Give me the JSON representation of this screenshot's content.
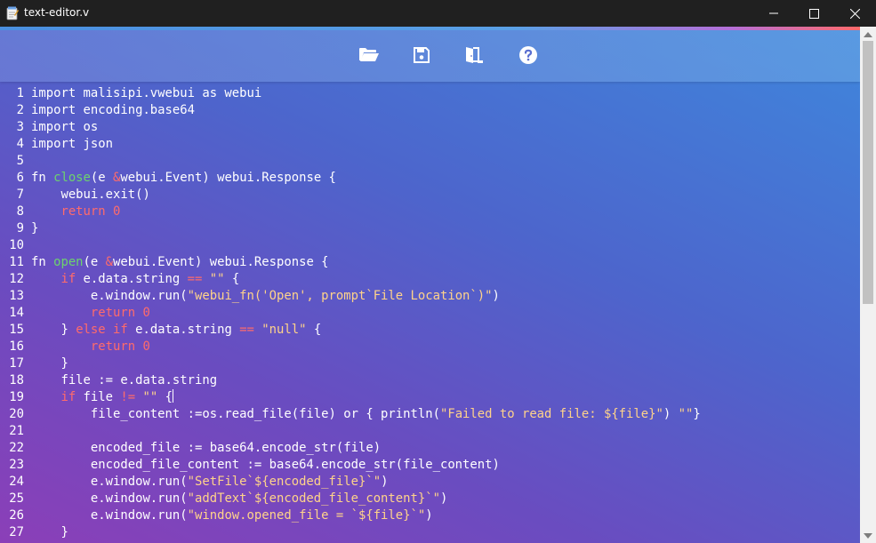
{
  "window": {
    "title": "text-editor.v",
    "app_icon": "notepad-icon",
    "controls": [
      "minimize-icon",
      "maximize-icon",
      "close-icon"
    ]
  },
  "toolbar": {
    "buttons": [
      {
        "name": "open-button",
        "icon": "folder-open-icon"
      },
      {
        "name": "save-button",
        "icon": "floppy-save-icon"
      },
      {
        "name": "exit-button",
        "icon": "door-exit-icon"
      },
      {
        "name": "help-button",
        "icon": "question-circle-icon"
      }
    ]
  },
  "colors": {
    "titlebar": "#202020",
    "keyword": "#ff6b6b",
    "function_name": "#6dd36d",
    "string": "#ffd38a",
    "number": "#ff6b6b",
    "text": "#ffffff"
  },
  "editor": {
    "lines": [
      {
        "n": "1",
        "tokens": [
          {
            "t": "import malisipi.vwebui as webui"
          }
        ]
      },
      {
        "n": "2",
        "tokens": [
          {
            "t": "import encoding.base64"
          }
        ]
      },
      {
        "n": "3",
        "tokens": [
          {
            "t": "import os"
          }
        ]
      },
      {
        "n": "4",
        "tokens": [
          {
            "t": "import json"
          }
        ]
      },
      {
        "n": "5",
        "tokens": []
      },
      {
        "n": "6",
        "tokens": [
          {
            "t": "fn "
          },
          {
            "t": "close",
            "c": "fnname"
          },
          {
            "t": "(e "
          },
          {
            "t": "&",
            "c": "kw"
          },
          {
            "t": "webui.Event) webui.Response {"
          }
        ]
      },
      {
        "n": "7",
        "tokens": [
          {
            "t": "    webui.exit()"
          }
        ]
      },
      {
        "n": "8",
        "tokens": [
          {
            "t": "    "
          },
          {
            "t": "return",
            "c": "kw"
          },
          {
            "t": " "
          },
          {
            "t": "0",
            "c": "num"
          }
        ]
      },
      {
        "n": "9",
        "tokens": [
          {
            "t": "}"
          }
        ]
      },
      {
        "n": "10",
        "tokens": []
      },
      {
        "n": "11",
        "tokens": [
          {
            "t": "fn "
          },
          {
            "t": "open",
            "c": "fnname"
          },
          {
            "t": "(e "
          },
          {
            "t": "&",
            "c": "kw"
          },
          {
            "t": "webui.Event) webui.Response {"
          }
        ]
      },
      {
        "n": "12",
        "tokens": [
          {
            "t": "    "
          },
          {
            "t": "if",
            "c": "kw"
          },
          {
            "t": " e.data.string "
          },
          {
            "t": "==",
            "c": "kw"
          },
          {
            "t": " "
          },
          {
            "t": "\"\"",
            "c": "str"
          },
          {
            "t": " {"
          }
        ]
      },
      {
        "n": "13",
        "tokens": [
          {
            "t": "        e.window.run("
          },
          {
            "t": "\"webui_fn('Open', prompt`File Location`)\"",
            "c": "str"
          },
          {
            "t": ")"
          }
        ]
      },
      {
        "n": "14",
        "tokens": [
          {
            "t": "        "
          },
          {
            "t": "return",
            "c": "kw"
          },
          {
            "t": " "
          },
          {
            "t": "0",
            "c": "num"
          }
        ]
      },
      {
        "n": "15",
        "tokens": [
          {
            "t": "    } "
          },
          {
            "t": "else if",
            "c": "kw"
          },
          {
            "t": " e.data.string "
          },
          {
            "t": "==",
            "c": "kw"
          },
          {
            "t": " "
          },
          {
            "t": "\"null\"",
            "c": "str"
          },
          {
            "t": " {"
          }
        ]
      },
      {
        "n": "16",
        "tokens": [
          {
            "t": "        "
          },
          {
            "t": "return",
            "c": "kw"
          },
          {
            "t": " "
          },
          {
            "t": "0",
            "c": "num"
          }
        ]
      },
      {
        "n": "17",
        "tokens": [
          {
            "t": "    }"
          }
        ]
      },
      {
        "n": "18",
        "tokens": [
          {
            "t": "    file := e.data.string"
          }
        ]
      },
      {
        "n": "19",
        "tokens": [
          {
            "t": "    "
          },
          {
            "t": "if",
            "c": "kw"
          },
          {
            "t": " file "
          },
          {
            "t": "!=",
            "c": "kw"
          },
          {
            "t": " "
          },
          {
            "t": "\"\"",
            "c": "str"
          },
          {
            "t": " {"
          },
          {
            "cursor": true
          }
        ]
      },
      {
        "n": "20",
        "tokens": [
          {
            "t": "        file_content :=os.read_file(file) or { println("
          },
          {
            "t": "\"Failed to read file: ${file}\"",
            "c": "str"
          },
          {
            "t": ") "
          },
          {
            "t": "\"\"",
            "c": "str"
          },
          {
            "t": "}"
          }
        ]
      },
      {
        "n": "21",
        "tokens": []
      },
      {
        "n": "22",
        "tokens": [
          {
            "t": "        encoded_file := base64.encode_str(file)"
          }
        ]
      },
      {
        "n": "23",
        "tokens": [
          {
            "t": "        encoded_file_content := base64.encode_str(file_content)"
          }
        ]
      },
      {
        "n": "24",
        "tokens": [
          {
            "t": "        e.window.run("
          },
          {
            "t": "\"SetFile`${encoded_file}`\"",
            "c": "str"
          },
          {
            "t": ")"
          }
        ]
      },
      {
        "n": "25",
        "tokens": [
          {
            "t": "        e.window.run("
          },
          {
            "t": "\"addText`${encoded_file_content}`\"",
            "c": "str"
          },
          {
            "t": ")"
          }
        ]
      },
      {
        "n": "26",
        "tokens": [
          {
            "t": "        e.window.run("
          },
          {
            "t": "\"window.opened_file = `${file}`\"",
            "c": "str"
          },
          {
            "t": ")"
          }
        ]
      },
      {
        "n": "27",
        "tokens": [
          {
            "t": "    }"
          }
        ]
      }
    ]
  }
}
